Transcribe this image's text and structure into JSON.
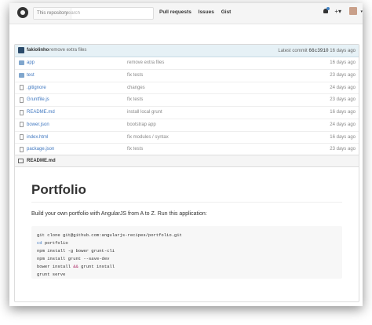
{
  "header": {
    "search_scope": "This repository",
    "search_placeholder": "Search",
    "nav": [
      "Pull requests",
      "Issues",
      "Gist"
    ],
    "plus_label": "+▾"
  },
  "commit": {
    "author": "fakiolinho",
    "message": "remove extra files",
    "latest_label": "Latest commit",
    "sha": "66c3910",
    "age": "16 days ago"
  },
  "files": [
    {
      "type": "folder",
      "name": "app",
      "message": "remove extra files",
      "age": "16 days ago"
    },
    {
      "type": "folder",
      "name": "test",
      "message": "fix tests",
      "age": "23 days ago"
    },
    {
      "type": "file",
      "name": ".gitignore",
      "message": "changes",
      "age": "24 days ago"
    },
    {
      "type": "file",
      "name": "Gruntfile.js",
      "message": "fix tests",
      "age": "23 days ago"
    },
    {
      "type": "file",
      "name": "README.md",
      "message": "install local grunt",
      "age": "16 days ago"
    },
    {
      "type": "file",
      "name": "bower.json",
      "message": "bootstrap app",
      "age": "24 days ago"
    },
    {
      "type": "file",
      "name": "index.html",
      "message": "fix modules / syntax",
      "age": "16 days ago"
    },
    {
      "type": "file",
      "name": "package.json",
      "message": "fix tests",
      "age": "23 days ago"
    }
  ],
  "readme": {
    "header": "README.md",
    "title": "Portfolio",
    "intro": "Build your own portfolio with AngularJS from A to Z. Run this application:",
    "code": [
      "git clone git@github.com:angularjs-recipes/portfolio.git",
      "cd portfolio",
      "npm install -g bower grunt-cli",
      "npm install grunt --save-dev",
      "bower install && grunt install",
      "grunt serve"
    ]
  },
  "colors": {
    "link": "#4078c0",
    "commit_bar": "#e6f1f6",
    "folder": "#80a6cd"
  }
}
